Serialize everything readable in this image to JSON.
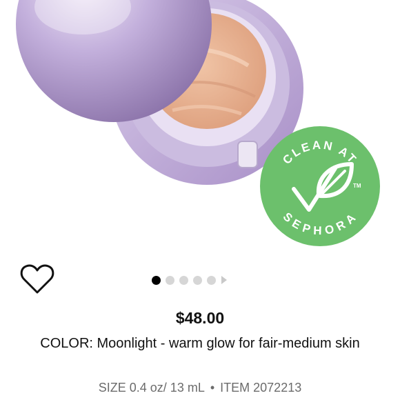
{
  "badge": {
    "top_text": "CLEAN AT",
    "bottom_text": "SEPHORA",
    "trademark": "TM",
    "color": "#6cc06c"
  },
  "gallery": {
    "dot_count": 5,
    "active_index": 0,
    "next_icon": "triangle-right-icon"
  },
  "favorite": {
    "icon": "heart-outline-icon"
  },
  "product": {
    "price": "$48.00",
    "color_line": "COLOR: Moonlight - warm glow for fair-medium skin",
    "size_text": "SIZE 0.4 oz/ 13 mL",
    "separator": "•",
    "item_text": "ITEM 2072213"
  },
  "colors": {
    "lid": "#b49fce",
    "cream": "#e8b392",
    "text_secondary": "#6b6b6b"
  }
}
